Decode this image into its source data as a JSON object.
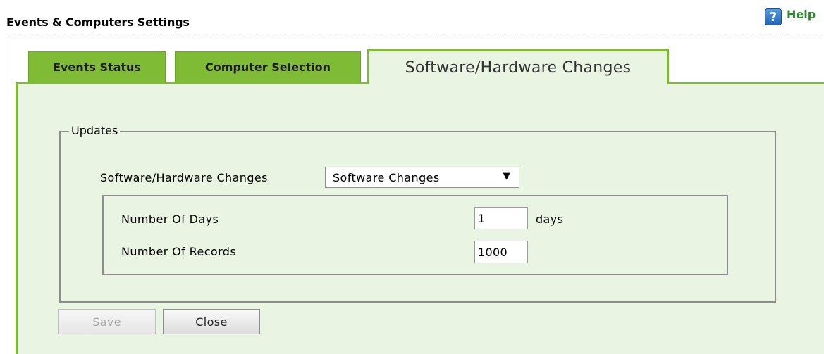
{
  "header": {
    "title": "Events & Computers Settings",
    "help_label": "Help",
    "help_icon_glyph": "?"
  },
  "tabs": [
    {
      "label": "Events Status",
      "active": false
    },
    {
      "label": "Computer Selection",
      "active": false
    },
    {
      "label": "Software/Hardware Changes",
      "active": true
    }
  ],
  "updates": {
    "legend": "Updates",
    "change_type_label": "Software/Hardware Changes",
    "change_type_value": "Software Changes",
    "arrow": "▼",
    "days_label": "Number Of Days",
    "days_value": "1",
    "days_unit": "days",
    "records_label": "Number Of Records",
    "records_value": "1000"
  },
  "buttons": {
    "save": "Save",
    "close": "Close"
  },
  "colors": {
    "tab_green": "#7fbb34",
    "panel_bg": "#eaf4e3",
    "help_text": "#2e8b2e"
  }
}
